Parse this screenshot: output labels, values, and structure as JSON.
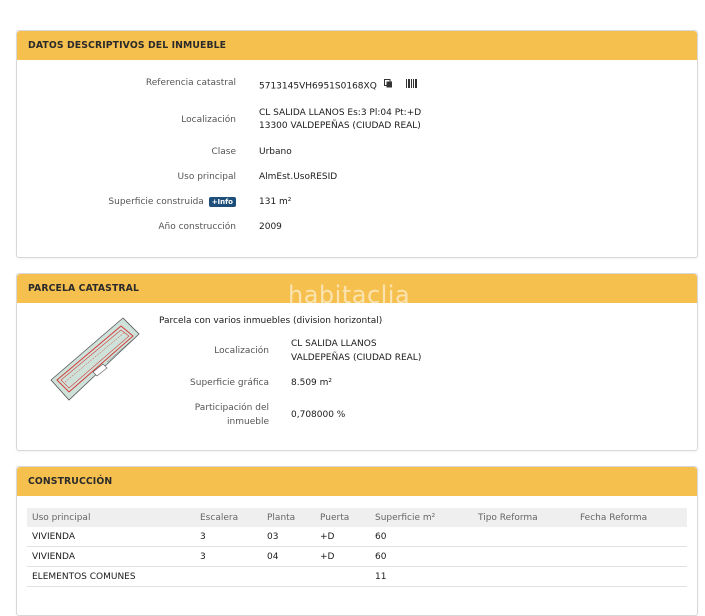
{
  "datos": {
    "title": "DATOS DESCRIPTIVOS DEL INMUEBLE",
    "referencia_label": "Referencia catastral",
    "referencia_value": "5713145VH6951S0168XQ",
    "localizacion_label": "Localización",
    "localizacion_line1": "CL SALIDA LLANOS Es:3 Pl:04 Pt:+D",
    "localizacion_line2": "13300 VALDEPEÑAS (CIUDAD REAL)",
    "clase_label": "Clase",
    "clase_value": "Urbano",
    "uso_label": "Uso principal",
    "uso_value": "AlmEst.UsoRESID",
    "superficie_label": "Superficie construida",
    "info_badge": "+Info",
    "superficie_value": "131 m²",
    "anio_label": "Año construcción",
    "anio_value": "2009"
  },
  "parcela": {
    "title": "PARCELA CATASTRAL",
    "descripcion": "Parcela con varios inmuebles (division horizontal)",
    "localizacion_label": "Localización",
    "localizacion_line1": "CL SALIDA LLANOS",
    "localizacion_line2": "VALDEPEÑAS (CIUDAD REAL)",
    "superficie_label": "Superficie gráfica",
    "superficie_value": "8.509 m²",
    "participacion_label_line1": "Participación del",
    "participacion_label_line2": "inmueble",
    "participacion_value": "0,708000 %"
  },
  "construccion": {
    "title": "CONSTRUCCIÓN",
    "columns": [
      "Uso principal",
      "Escalera",
      "Planta",
      "Puerta",
      "Superficie m²",
      "Tipo Reforma",
      "Fecha Reforma"
    ],
    "rows": [
      [
        "VIVIENDA",
        "3",
        "03",
        "+D",
        "60",
        "",
        ""
      ],
      [
        "VIVIENDA",
        "3",
        "04",
        "+D",
        "60",
        "",
        ""
      ],
      [
        "ELEMENTOS COMUNES",
        "",
        "",
        "",
        "11",
        "",
        ""
      ]
    ]
  },
  "watermark": "habitaclia",
  "colors": {
    "header": "#f6c04e",
    "badge": "#1e4f7a"
  }
}
